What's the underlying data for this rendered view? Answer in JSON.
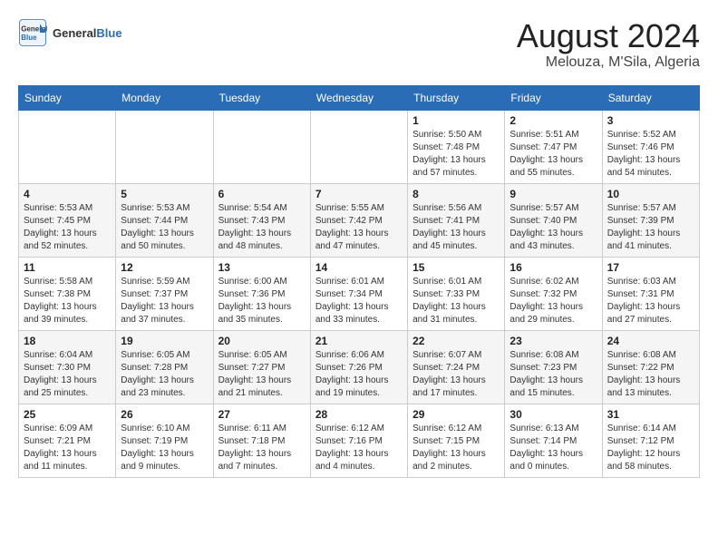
{
  "header": {
    "logo_line1": "General",
    "logo_line2": "Blue",
    "month_year": "August 2024",
    "location": "Melouza, M'Sila, Algeria"
  },
  "weekdays": [
    "Sunday",
    "Monday",
    "Tuesday",
    "Wednesday",
    "Thursday",
    "Friday",
    "Saturday"
  ],
  "weeks": [
    [
      {
        "day": "",
        "detail": ""
      },
      {
        "day": "",
        "detail": ""
      },
      {
        "day": "",
        "detail": ""
      },
      {
        "day": "",
        "detail": ""
      },
      {
        "day": "1",
        "detail": "Sunrise: 5:50 AM\nSunset: 7:48 PM\nDaylight: 13 hours\nand 57 minutes."
      },
      {
        "day": "2",
        "detail": "Sunrise: 5:51 AM\nSunset: 7:47 PM\nDaylight: 13 hours\nand 55 minutes."
      },
      {
        "day": "3",
        "detail": "Sunrise: 5:52 AM\nSunset: 7:46 PM\nDaylight: 13 hours\nand 54 minutes."
      }
    ],
    [
      {
        "day": "4",
        "detail": "Sunrise: 5:53 AM\nSunset: 7:45 PM\nDaylight: 13 hours\nand 52 minutes."
      },
      {
        "day": "5",
        "detail": "Sunrise: 5:53 AM\nSunset: 7:44 PM\nDaylight: 13 hours\nand 50 minutes."
      },
      {
        "day": "6",
        "detail": "Sunrise: 5:54 AM\nSunset: 7:43 PM\nDaylight: 13 hours\nand 48 minutes."
      },
      {
        "day": "7",
        "detail": "Sunrise: 5:55 AM\nSunset: 7:42 PM\nDaylight: 13 hours\nand 47 minutes."
      },
      {
        "day": "8",
        "detail": "Sunrise: 5:56 AM\nSunset: 7:41 PM\nDaylight: 13 hours\nand 45 minutes."
      },
      {
        "day": "9",
        "detail": "Sunrise: 5:57 AM\nSunset: 7:40 PM\nDaylight: 13 hours\nand 43 minutes."
      },
      {
        "day": "10",
        "detail": "Sunrise: 5:57 AM\nSunset: 7:39 PM\nDaylight: 13 hours\nand 41 minutes."
      }
    ],
    [
      {
        "day": "11",
        "detail": "Sunrise: 5:58 AM\nSunset: 7:38 PM\nDaylight: 13 hours\nand 39 minutes."
      },
      {
        "day": "12",
        "detail": "Sunrise: 5:59 AM\nSunset: 7:37 PM\nDaylight: 13 hours\nand 37 minutes."
      },
      {
        "day": "13",
        "detail": "Sunrise: 6:00 AM\nSunset: 7:36 PM\nDaylight: 13 hours\nand 35 minutes."
      },
      {
        "day": "14",
        "detail": "Sunrise: 6:01 AM\nSunset: 7:34 PM\nDaylight: 13 hours\nand 33 minutes."
      },
      {
        "day": "15",
        "detail": "Sunrise: 6:01 AM\nSunset: 7:33 PM\nDaylight: 13 hours\nand 31 minutes."
      },
      {
        "day": "16",
        "detail": "Sunrise: 6:02 AM\nSunset: 7:32 PM\nDaylight: 13 hours\nand 29 minutes."
      },
      {
        "day": "17",
        "detail": "Sunrise: 6:03 AM\nSunset: 7:31 PM\nDaylight: 13 hours\nand 27 minutes."
      }
    ],
    [
      {
        "day": "18",
        "detail": "Sunrise: 6:04 AM\nSunset: 7:30 PM\nDaylight: 13 hours\nand 25 minutes."
      },
      {
        "day": "19",
        "detail": "Sunrise: 6:05 AM\nSunset: 7:28 PM\nDaylight: 13 hours\nand 23 minutes."
      },
      {
        "day": "20",
        "detail": "Sunrise: 6:05 AM\nSunset: 7:27 PM\nDaylight: 13 hours\nand 21 minutes."
      },
      {
        "day": "21",
        "detail": "Sunrise: 6:06 AM\nSunset: 7:26 PM\nDaylight: 13 hours\nand 19 minutes."
      },
      {
        "day": "22",
        "detail": "Sunrise: 6:07 AM\nSunset: 7:24 PM\nDaylight: 13 hours\nand 17 minutes."
      },
      {
        "day": "23",
        "detail": "Sunrise: 6:08 AM\nSunset: 7:23 PM\nDaylight: 13 hours\nand 15 minutes."
      },
      {
        "day": "24",
        "detail": "Sunrise: 6:08 AM\nSunset: 7:22 PM\nDaylight: 13 hours\nand 13 minutes."
      }
    ],
    [
      {
        "day": "25",
        "detail": "Sunrise: 6:09 AM\nSunset: 7:21 PM\nDaylight: 13 hours\nand 11 minutes."
      },
      {
        "day": "26",
        "detail": "Sunrise: 6:10 AM\nSunset: 7:19 PM\nDaylight: 13 hours\nand 9 minutes."
      },
      {
        "day": "27",
        "detail": "Sunrise: 6:11 AM\nSunset: 7:18 PM\nDaylight: 13 hours\nand 7 minutes."
      },
      {
        "day": "28",
        "detail": "Sunrise: 6:12 AM\nSunset: 7:16 PM\nDaylight: 13 hours\nand 4 minutes."
      },
      {
        "day": "29",
        "detail": "Sunrise: 6:12 AM\nSunset: 7:15 PM\nDaylight: 13 hours\nand 2 minutes."
      },
      {
        "day": "30",
        "detail": "Sunrise: 6:13 AM\nSunset: 7:14 PM\nDaylight: 13 hours\nand 0 minutes."
      },
      {
        "day": "31",
        "detail": "Sunrise: 6:14 AM\nSunset: 7:12 PM\nDaylight: 12 hours\nand 58 minutes."
      }
    ]
  ]
}
